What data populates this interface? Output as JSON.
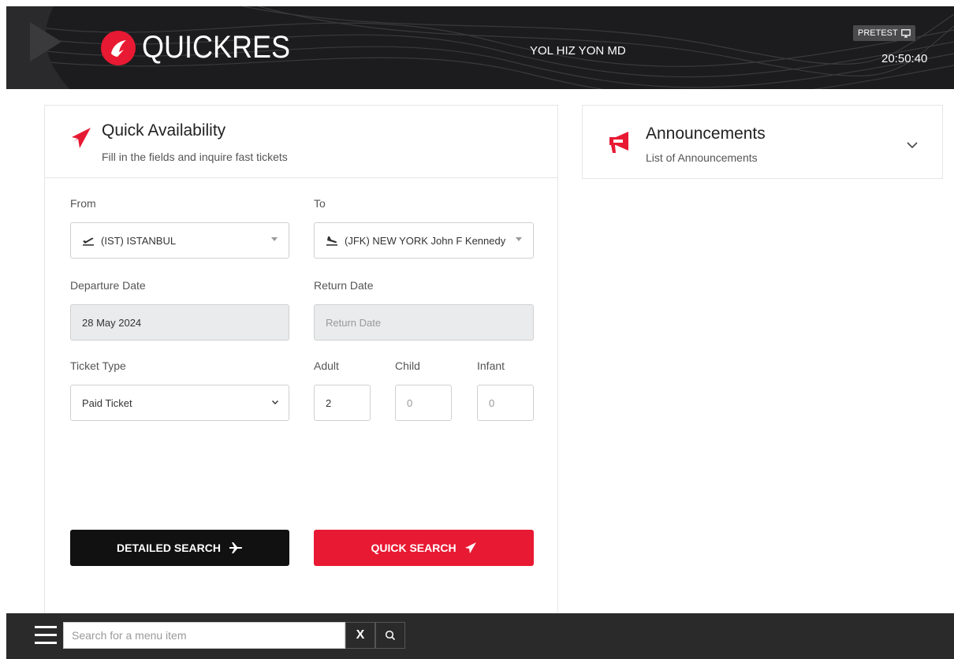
{
  "header": {
    "logo_text": "QUICKRES",
    "user_name": "YOL HIZ YON MD",
    "environment": "PRETEST",
    "clock": "20:50:40"
  },
  "quick_availability": {
    "title": "Quick Availability",
    "subtitle": "Fill in the fields and inquire fast tickets",
    "from_label": "From",
    "from_value": "(IST) ISTANBUL",
    "to_label": "To",
    "to_value": "(JFK) NEW YORK John F Kennedy",
    "departure_label": "Departure Date",
    "departure_value": "28 May 2024",
    "return_label": "Return Date",
    "return_placeholder": "Return Date",
    "ticket_type_label": "Ticket Type",
    "ticket_type_value": "Paid Ticket",
    "adult_label": "Adult",
    "adult_value": "2",
    "child_label": "Child",
    "child_value": "0",
    "infant_label": "Infant",
    "infant_value": "0",
    "detailed_search_label": "DETAILED SEARCH",
    "quick_search_label": "QUICK SEARCH"
  },
  "announcements": {
    "title": "Announcements",
    "subtitle": "List of Announcements"
  },
  "bottom_bar": {
    "search_placeholder": "Search for a menu item",
    "clear_label": "X"
  },
  "colors": {
    "brand_red": "#e81932",
    "header_bg": "#1c1c1e",
    "bottom_bg": "#2a2a2a"
  }
}
